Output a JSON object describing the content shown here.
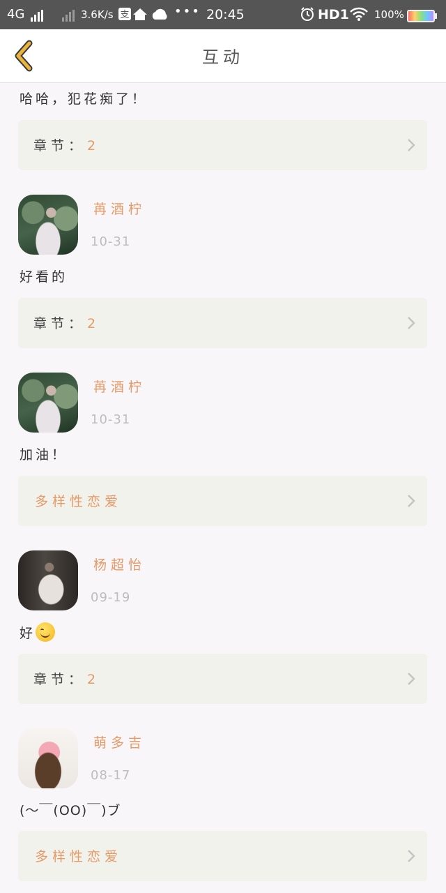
{
  "status_bar": {
    "network": "4G",
    "speed": "3.6K/s",
    "time": "20:45",
    "hd": "HD1",
    "battery": "100%"
  },
  "header": {
    "title": "互动"
  },
  "feed": {
    "partial_text": "哈哈，犯花痴了！",
    "partial_ref": {
      "label": "章节：",
      "value": "2"
    },
    "items": [
      {
        "user": "苒酒柠",
        "date": "10-31",
        "text": "好看的",
        "ref_label": "章节：",
        "ref_value": "2"
      },
      {
        "user": "苒酒柠",
        "date": "10-31",
        "text": "加油！",
        "ref_tag": "多样性恋爱"
      },
      {
        "user": "杨超怡",
        "date": "09-19",
        "text": "好",
        "emoji": "smiling-face",
        "ref_label": "章节：",
        "ref_value": "2"
      },
      {
        "user": "萌多吉",
        "date": "08-17",
        "text": "(～￣(OO)￣)ブ",
        "ref_tag": "多样性恋爱"
      }
    ]
  },
  "colors": {
    "accent": "#e69a67",
    "ref_bg": "#f2f2ec",
    "back_arrow": "#e8b43c"
  }
}
